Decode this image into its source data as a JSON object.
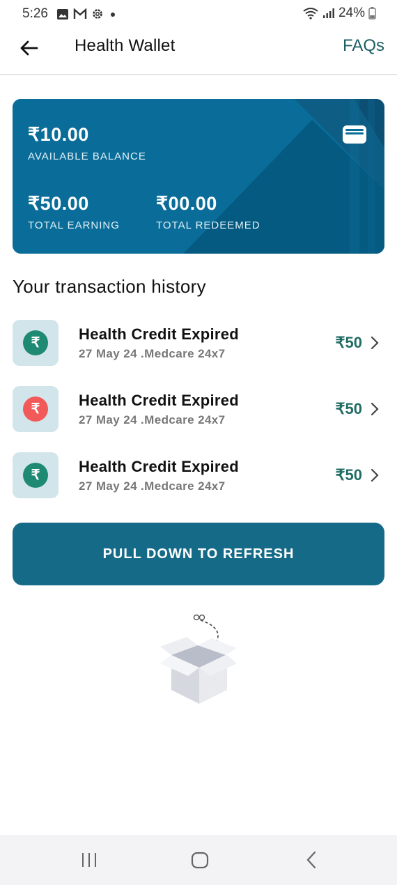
{
  "status_bar": {
    "time": "5:26",
    "battery": "24%",
    "icons": [
      "image-icon",
      "gmail-icon",
      "settings-icon",
      "dot-icon",
      "wifi-icon",
      "signal-icon",
      "battery-icon"
    ]
  },
  "app_bar": {
    "title": "Health Wallet",
    "faqs_label": "FAQs",
    "back_icon": "arrow-left-icon"
  },
  "wallet_card": {
    "available_balance_value": "₹10.00",
    "available_balance_label": "AVAILABLE BALANCE",
    "total_earning_value": "₹50.00",
    "total_earning_label": "TOTAL EARNING",
    "total_redeemed_value": "₹00.00",
    "total_redeemed_label": "TOTAL REDEEMED",
    "icon": "wallet-icon"
  },
  "history": {
    "title": "Your transaction history",
    "items": [
      {
        "title": "Health Credit Expired",
        "subtitle": "27 May 24 .Medcare 24x7",
        "amount": "₹50",
        "coin_symbol": "₹",
        "coin_color": "#1e8a73"
      },
      {
        "title": "Health Credit Expired",
        "subtitle": "27 May 24 .Medcare 24x7",
        "amount": "₹50",
        "coin_symbol": "₹",
        "coin_color": "#f25a5a"
      },
      {
        "title": "Health Credit Expired",
        "subtitle": "27 May 24 .Medcare 24x7",
        "amount": "₹50",
        "coin_symbol": "₹",
        "coin_color": "#1e8a73"
      }
    ]
  },
  "refresh_button": {
    "label": "PULL DOWN TO REFRESH"
  },
  "empty_state": {
    "icon": "empty-box-icon"
  },
  "nav_bar": {
    "icons": [
      "recent-apps-icon",
      "home-icon",
      "back-icon"
    ]
  },
  "colors": {
    "card_bg": "#0a6d99",
    "accent_teal": "#1b5e63",
    "button_bg": "#156a87",
    "amount_green": "#1f6d63"
  }
}
